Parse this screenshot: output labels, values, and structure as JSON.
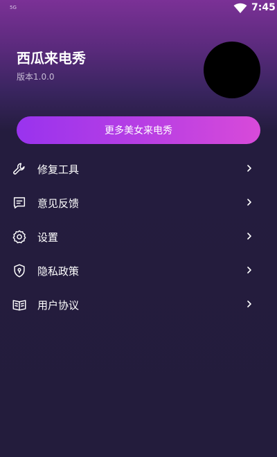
{
  "status_bar": {
    "network": "5G",
    "time": "7:45"
  },
  "header": {
    "app_name": "西瓜来电秀",
    "version": "版本1.0.0"
  },
  "promo": {
    "label": "更多美女来电秀"
  },
  "menu": {
    "items": [
      {
        "label": "修复工具",
        "icon": "wrench-icon"
      },
      {
        "label": "意见反馈",
        "icon": "feedback-message-icon"
      },
      {
        "label": "设置",
        "icon": "gear-icon"
      },
      {
        "label": "隐私政策",
        "icon": "shield-icon"
      },
      {
        "label": "用户协议",
        "icon": "book-icon"
      }
    ]
  },
  "colors": {
    "background": "#231c3c",
    "header_top": "#7b3196",
    "button_start": "#9933ee",
    "button_end": "#d84ad9",
    "avatar": "#000000"
  }
}
